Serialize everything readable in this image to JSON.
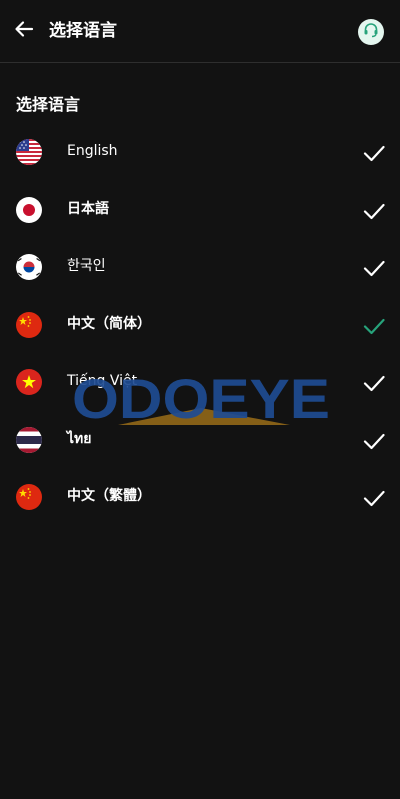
{
  "header": {
    "title": "选择语言",
    "back_icon": "arrow-left-icon",
    "support_icon": "headset-icon",
    "support_icon_color": "#27a37b"
  },
  "section": {
    "title": "选择语言"
  },
  "languages": [
    {
      "label": "English",
      "flag": "us-flag-icon",
      "checked": true
    },
    {
      "label": "日本語",
      "flag": "japan-flag-icon",
      "checked": true
    },
    {
      "label": "한국인",
      "flag": "korea-flag-icon",
      "checked": true
    },
    {
      "label": "中文（简体）",
      "flag": "china-flag-icon",
      "checked": true,
      "selected": true
    },
    {
      "label": "Tiếng Việt",
      "flag": "vietnam-flag-icon",
      "checked": true
    },
    {
      "label": "ไทย",
      "flag": "thailand-flag-icon",
      "checked": true
    },
    {
      "label": "中文（繁體）",
      "flag": "china-flag-icon",
      "checked": true
    }
  ],
  "colors": {
    "background": "#121212",
    "check_default": "#ffffff",
    "check_selected": "#27a37b"
  },
  "watermark": {
    "text": "ODOEYE"
  }
}
